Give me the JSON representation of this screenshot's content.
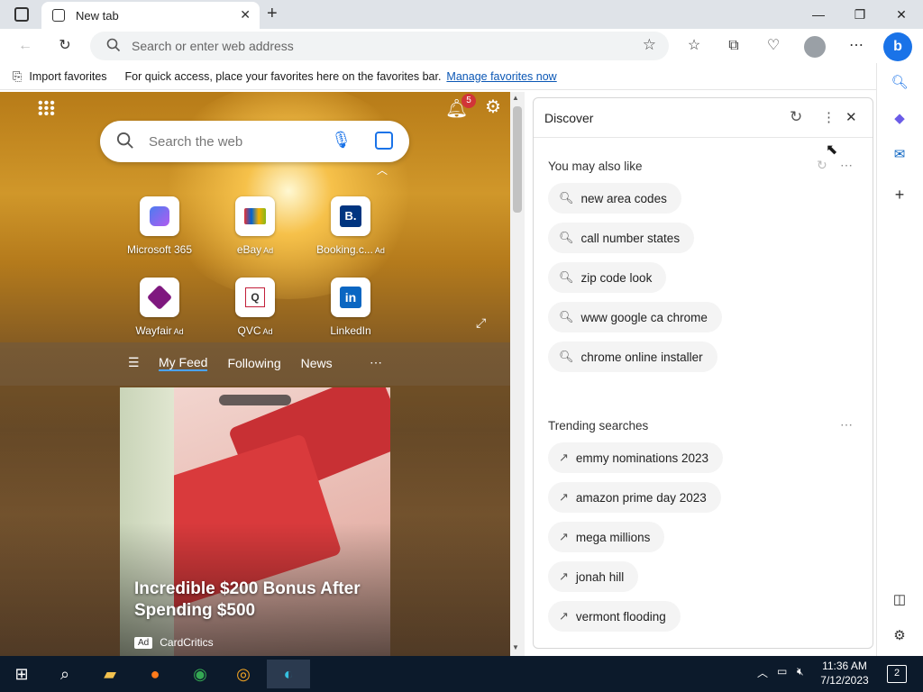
{
  "browser": {
    "tab_title": "New tab",
    "address_placeholder": "Search or enter web address"
  },
  "favbar": {
    "import_label": "Import favorites",
    "hint": "For quick access, place your favorites here on the favorites bar.",
    "manage_link": "Manage favorites now"
  },
  "newtab": {
    "search_placeholder": "Search the web",
    "notification_count": "5",
    "tiles": [
      {
        "label": "Microsoft 365",
        "ad": ""
      },
      {
        "label": "eBay",
        "ad": "Ad"
      },
      {
        "label": "Booking.c...",
        "ad": "Ad"
      },
      {
        "label": "Wayfair",
        "ad": "Ad"
      },
      {
        "label": "QVC",
        "ad": "Ad"
      },
      {
        "label": "LinkedIn",
        "ad": ""
      }
    ],
    "feed_tabs": [
      "My Feed",
      "Following",
      "News"
    ],
    "card": {
      "title": "Incredible $200 Bonus After Spending $500",
      "ad_badge": "Ad",
      "source": "CardCritics"
    }
  },
  "discover": {
    "title": "Discover",
    "also_like_heading": "You may also like",
    "also_like": [
      "new area codes",
      "call number states",
      "zip code look",
      "www google ca chrome",
      "chrome online installer"
    ],
    "trending_heading": "Trending searches",
    "trending": [
      "emmy nominations 2023",
      "amazon prime day 2023",
      "mega millions",
      "jonah hill",
      "vermont flooding"
    ]
  },
  "taskbar": {
    "time": "11:36 AM",
    "date": "7/12/2023",
    "notification_count": "2"
  },
  "colors": {
    "accent": "#0b57b5",
    "taskbar": "#0c1a2b",
    "badge": "#d13438"
  }
}
